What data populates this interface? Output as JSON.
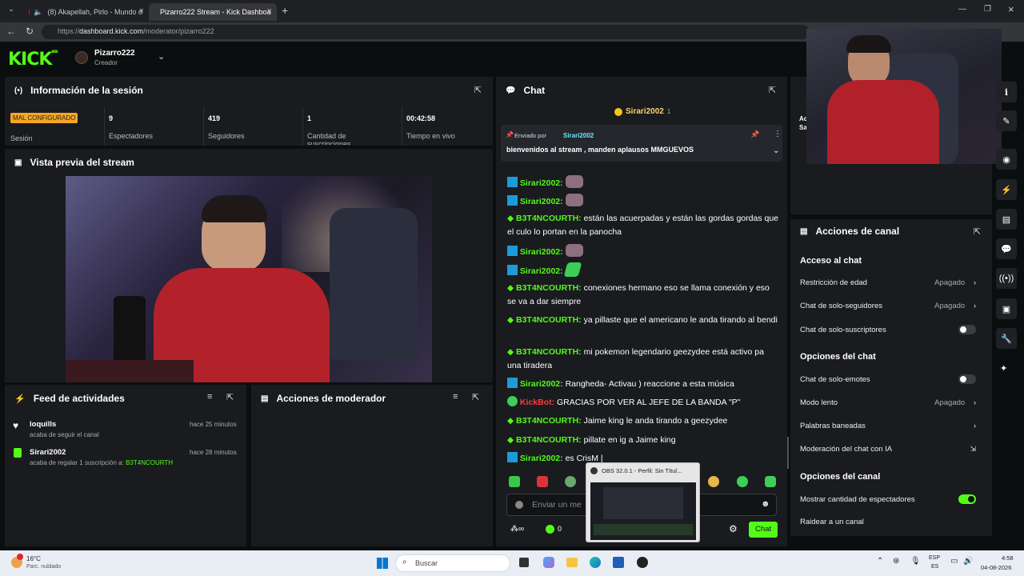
{
  "browser": {
    "tabs": [
      {
        "label": "(8) Akapellah, Pirlo - Mundo d"
      },
      {
        "label": "Pizarro222 Stream - Kick Dashboa"
      }
    ],
    "new_tab": "+",
    "url_prefix": "https://",
    "url_host": "dashboard.kick.com",
    "url_path": "/moderator/pizarro222"
  },
  "header": {
    "logo": "KICK",
    "logo_badge": "BETA",
    "channel_name": "Pizarro222",
    "channel_role": "Creador"
  },
  "session": {
    "title": "Información de la sesión",
    "status_badge": "MAL CONFIGURADO",
    "status_label": "Sesión",
    "stats": [
      {
        "value": "9",
        "label": "Espectadores"
      },
      {
        "value": "419",
        "label": "Seguidores"
      },
      {
        "value": "1",
        "label": "Cantidad de suscripciones"
      },
      {
        "value": "00:42:58",
        "label": "Tiempo en vivo"
      }
    ]
  },
  "preview": {
    "title": "Vista previa del stream"
  },
  "activity": {
    "title": "Feed de actividades",
    "items": [
      {
        "user": "loquills",
        "desc": "acaba de seguir el canal",
        "time": "hace 25 minutos",
        "icon": "heart-icon"
      },
      {
        "user": "Sirari2002",
        "desc": "acaba de regalar 1 suscripción a:",
        "target": "B3T4NCOURTH",
        "time": "hace 28 minutos",
        "icon": "gift-icon"
      }
    ]
  },
  "moderator_actions": {
    "title": "Acciones de moderador"
  },
  "chat": {
    "title": "Chat",
    "top_gifter": "Sirari2002",
    "top_gifter_count": "1",
    "pinned": {
      "sent_by_label": "Enviado por",
      "sent_by_user": "Sirari2002",
      "message": "bienvenidos al stream , manden aplausos MMGUEVOS"
    },
    "messages": [
      {
        "user": "Sirari2002:",
        "text": "",
        "type": "sub"
      },
      {
        "user": "Sirari2002:",
        "text": "",
        "type": "sub"
      },
      {
        "user": "B3T4NCOURTH:",
        "text": "están las acuerpadas y están las gordas gordas que el culo lo portan en la panocha",
        "type": "vip"
      },
      {
        "user": "Sirari2002:",
        "text": "",
        "type": "sub"
      },
      {
        "user": "Sirari2002:",
        "text": "",
        "type": "sub"
      },
      {
        "user": "B3T4NCOURTH:",
        "text": "conexiones hermano eso se llama conexión y eso se va a dar siempre",
        "type": "vip"
      },
      {
        "user": "B3T4NCOURTH:",
        "text": "ya pillaste que el americano le anda tirando al bendi",
        "type": "vip"
      },
      {
        "user": "B3T4NCOURTH:",
        "text": "mi pokemon legendario geezydee está activo pa una tiradera",
        "type": "vip"
      },
      {
        "user": "Sirari2002:",
        "text": "Rangheda- Activau ) reaccione a esta música",
        "type": "sub"
      },
      {
        "user": "KickBot:",
        "text": "GRACIAS POR VER AL JEFE DE LA BANDA \"P\"",
        "type": "bot"
      },
      {
        "user": "B3T4NCOURTH:",
        "text": "Jaime king le anda tirando a geezydee",
        "type": "vip"
      },
      {
        "user": "B3T4NCOURTH:",
        "text": "pillate en ig a Jaime king",
        "type": "vip"
      },
      {
        "user": "Sirari2002:",
        "text": "es CrisM |",
        "type": "sub"
      }
    ],
    "input_placeholder": "Enviar un me",
    "points": "0",
    "send_label": "Chat"
  },
  "obs_popup": {
    "title": "OBS 32.0.1 - Perfil: Sin Títul..."
  },
  "channel_actions": {
    "title": "Acciones de canal",
    "sections": [
      {
        "heading": "Acceso al chat",
        "rows": [
          {
            "label": "Restricción de edad",
            "value": "Apagado",
            "kind": "chevron"
          },
          {
            "label": "Chat de solo-seguidores",
            "value": "Apagado",
            "kind": "chevron"
          },
          {
            "label": "Chat de solo-suscriptores",
            "value": "",
            "kind": "toggle-off"
          }
        ]
      },
      {
        "heading": "Opciones del chat",
        "rows": [
          {
            "label": "Chat de solo-emotes",
            "value": "",
            "kind": "toggle-off"
          },
          {
            "label": "Modo lento",
            "value": "Apagado",
            "kind": "chevron"
          },
          {
            "label": "Palabras baneadas",
            "value": "",
            "kind": "chevron"
          },
          {
            "label": "Moderación del chat con IA",
            "value": "",
            "kind": "external"
          }
        ]
      },
      {
        "heading": "Opciones del canal",
        "rows": [
          {
            "label": "Mostrar cantidad de espectadores",
            "value": "",
            "kind": "toggle-on"
          },
          {
            "label": "Raidear a un canal",
            "value": "",
            "kind": "none"
          }
        ]
      }
    ]
  },
  "side_partial": {
    "line1": "Ac",
    "line2": "Sa"
  },
  "taskbar": {
    "weather_temp": "16°C",
    "weather_desc": "Parc. nublado",
    "search_label": "Buscar",
    "lang_top": "ESP",
    "lang_bottom": "ES",
    "time": "4:58",
    "date": "04-08-2026"
  },
  "colors": {
    "accent": "#53fc18",
    "panel": "#191b1f",
    "badge": "#f5a623"
  }
}
